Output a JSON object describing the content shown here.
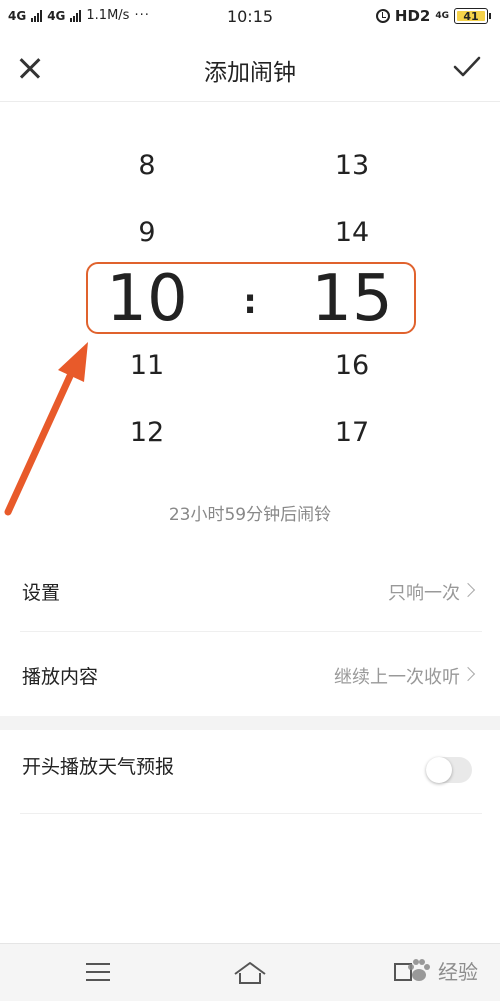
{
  "status_bar": {
    "net1": "4G",
    "net2": "4G",
    "speed": "1.1M/s",
    "dots": "···",
    "time": "10:15",
    "hd": "HD2",
    "net3": "4G",
    "battery_level": "41"
  },
  "header": {
    "title": "添加闹钟"
  },
  "picker": {
    "hours": [
      "8",
      "9",
      "10",
      "11",
      "12"
    ],
    "minutes": [
      "13",
      "14",
      "15",
      "16",
      "17"
    ],
    "selected_hour": "10",
    "selected_minute": "15",
    "separator": ":"
  },
  "countdown": "23小时59分钟后闹铃",
  "settings": {
    "repeat": {
      "label": "设置",
      "value": "只响一次"
    },
    "content": {
      "label": "播放内容",
      "value": "继续上一次收听"
    },
    "weather": {
      "label": "开头播放天气预报",
      "enabled": false
    }
  },
  "watermark": "经验",
  "colors": {
    "accent": "#e0622d",
    "muted_text": "#999999"
  }
}
